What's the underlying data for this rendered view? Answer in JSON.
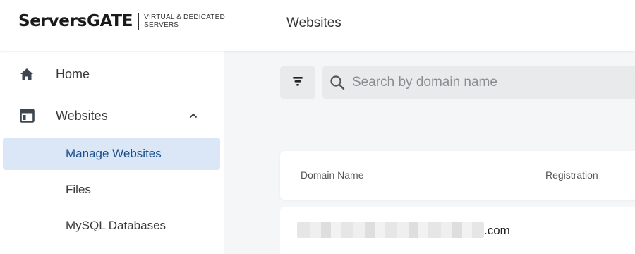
{
  "header": {
    "logo_text": "ServersGATE",
    "logo_tagline_1": "VIRTUAL & DEDICATED",
    "logo_tagline_2": "SERVERS",
    "page_title": "Websites"
  },
  "sidebar": {
    "items": [
      {
        "label": "Home",
        "icon": "home-icon"
      },
      {
        "label": "Websites",
        "icon": "websites-icon",
        "expanded": true
      }
    ],
    "sub_items": [
      {
        "label": "Manage Websites",
        "active": true
      },
      {
        "label": "Files",
        "active": false
      },
      {
        "label": "MySQL Databases",
        "active": false
      }
    ]
  },
  "toolbar": {
    "filter_icon": "filter-icon",
    "search_placeholder": "Search by domain name",
    "search_value": ""
  },
  "table": {
    "columns": [
      "Domain Name",
      "Registration"
    ],
    "rows": [
      {
        "domain_suffix": ".com"
      }
    ]
  },
  "colors": {
    "active_bg": "#dbe7f6",
    "active_text": "#1b4f8a",
    "page_bg": "#f5f6f7"
  }
}
